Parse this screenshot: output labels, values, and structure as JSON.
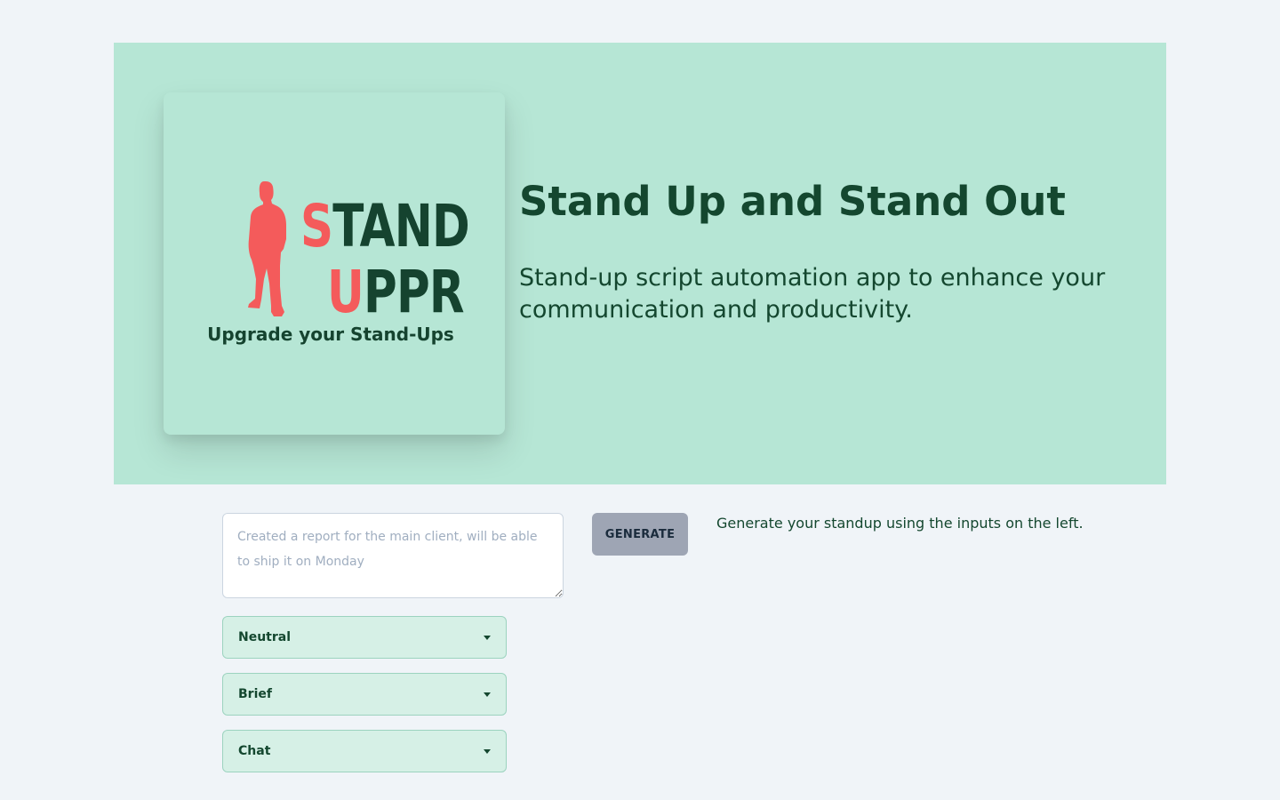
{
  "colors": {
    "page_bg": "#f0f4f8",
    "hero_bg": "#b6e6d5",
    "brand_dark": "#14472f",
    "brand_accent": "#f45b5b",
    "button_bg": "#9ea5b4",
    "select_bg": "#d6f0e6"
  },
  "logo": {
    "word1_accent": "S",
    "word1_rest": "TAND",
    "word2_accent": "U",
    "word2_rest": "PPR",
    "tagline": "Upgrade your Stand-Ups",
    "icon": "person-silhouette-icon"
  },
  "hero": {
    "title": "Stand Up and Stand Out",
    "subtitle": "Stand-up script automation app to enhance your communication and productivity."
  },
  "form": {
    "notes_value": "",
    "notes_placeholder": "Created a report for the main client, will be able to ship it on Monday",
    "generate_label": "GENERATE",
    "hint": "Generate your standup using the inputs on the left.",
    "tone_select": {
      "selected": "Neutral",
      "icon": "caret-down-icon"
    },
    "length_select": {
      "selected": "Brief",
      "icon": "caret-down-icon"
    },
    "format_select": {
      "selected": "Chat",
      "icon": "caret-down-icon"
    }
  }
}
